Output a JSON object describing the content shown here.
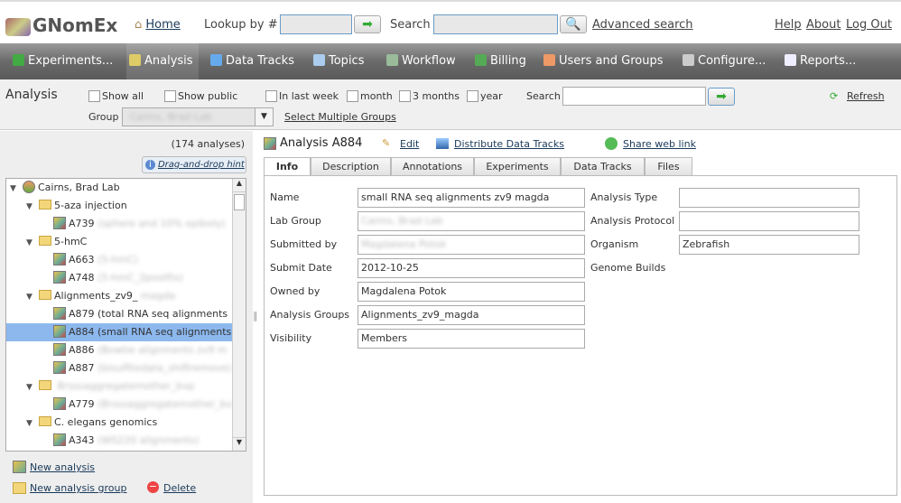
{
  "header": {
    "logo": "GNomEx",
    "home": "Home",
    "lookup_label": "Lookup by #",
    "lookup_value": "",
    "search_label": "Search",
    "search_value": "",
    "advanced_search": "Advanced search",
    "help": "Help",
    "about": "About",
    "logout": "Log Out"
  },
  "nav": [
    "Experiments...",
    "Analysis",
    "Data Tracks",
    "Topics",
    "Workflow",
    "Billing",
    "Users and Groups",
    "Configure...",
    "Reports..."
  ],
  "filter": {
    "title": "Analysis",
    "show_all": "Show all",
    "show_public": "Show public",
    "last_week": "In last week",
    "month": "month",
    "three_months": "3 months",
    "year": "year",
    "search_label": "Search",
    "search_value": "",
    "refresh": "Refresh",
    "group_label": "Group",
    "group_value": "Cairns, Brad Lab",
    "select_multiple": "Select Multiple Groups"
  },
  "left": {
    "count": "(174 analyses)",
    "hint": "Drag-and-drop hint",
    "new_analysis": "New analysis",
    "new_group": "New analysis group",
    "delete": "Delete",
    "tree": [
      {
        "level": 0,
        "type": "lab",
        "text": "Cairns, Brad Lab"
      },
      {
        "level": 1,
        "type": "folder",
        "text": "5-aza injection"
      },
      {
        "level": 2,
        "type": "analysis",
        "text": "A739",
        "blur": "(sphere and 10% epiboly)"
      },
      {
        "level": 1,
        "type": "folder",
        "text": "5-hmC"
      },
      {
        "level": 2,
        "type": "analysis",
        "text": "A663",
        "blur": "(5-hmC)"
      },
      {
        "level": 2,
        "type": "analysis",
        "text": "A748",
        "blur": "(5-hmC_2postfix)"
      },
      {
        "level": 1,
        "type": "folder",
        "text": "Alignments_zv9_",
        "blur": "magda"
      },
      {
        "level": 2,
        "type": "analysis",
        "text": "A879 (total RNA seq alignments",
        "blur": ""
      },
      {
        "level": 2,
        "type": "analysis",
        "text": "A884 (small RNA seq alignments",
        "blur": "",
        "selected": true
      },
      {
        "level": 2,
        "type": "analysis",
        "text": "A886",
        "blur": "(Bowtie alignments zv9 m"
      },
      {
        "level": 2,
        "type": "analysis",
        "text": "A887",
        "blur": "(bisulfitedata_shiftremove)"
      },
      {
        "level": 1,
        "type": "folder",
        "text": "",
        "blur": "Brsssaggregatemother_bvp"
      },
      {
        "level": 2,
        "type": "analysis",
        "text": "A779",
        "blur": "(Brsssaggregatemother_bv"
      },
      {
        "level": 1,
        "type": "folder",
        "text": "C. elegans genomics"
      },
      {
        "level": 2,
        "type": "analysis",
        "text": "A343",
        "blur": "(WS220 alignments)"
      }
    ]
  },
  "detail": {
    "title": "Analysis A884",
    "edit": "Edit",
    "distribute": "Distribute Data Tracks",
    "share": "Share web link",
    "tabs": [
      "Info",
      "Description",
      "Annotations",
      "Experiments",
      "Data Tracks",
      "Files"
    ],
    "active_tab": "Info",
    "fields": {
      "name_label": "Name",
      "name": "small RNA seq alignments zv9 magda",
      "lab_label": "Lab Group",
      "lab": "Cairns, Brad Lab",
      "submitted_label": "Submitted by",
      "submitted": "Magdalena Potok",
      "date_label": "Submit Date",
      "date": "2012-10-25",
      "owner_label": "Owned by",
      "owner": "Magdalena Potok",
      "groups_label": "Analysis Groups",
      "groups": "Alignments_zv9_magda",
      "visibility_label": "Visibility",
      "visibility": "Members",
      "type_label": "Analysis Type",
      "type": "",
      "protocol_label": "Analysis Protocol",
      "protocol": "",
      "organism_label": "Organism",
      "organism": "Zebrafish",
      "builds_label": "Genome Builds"
    }
  }
}
